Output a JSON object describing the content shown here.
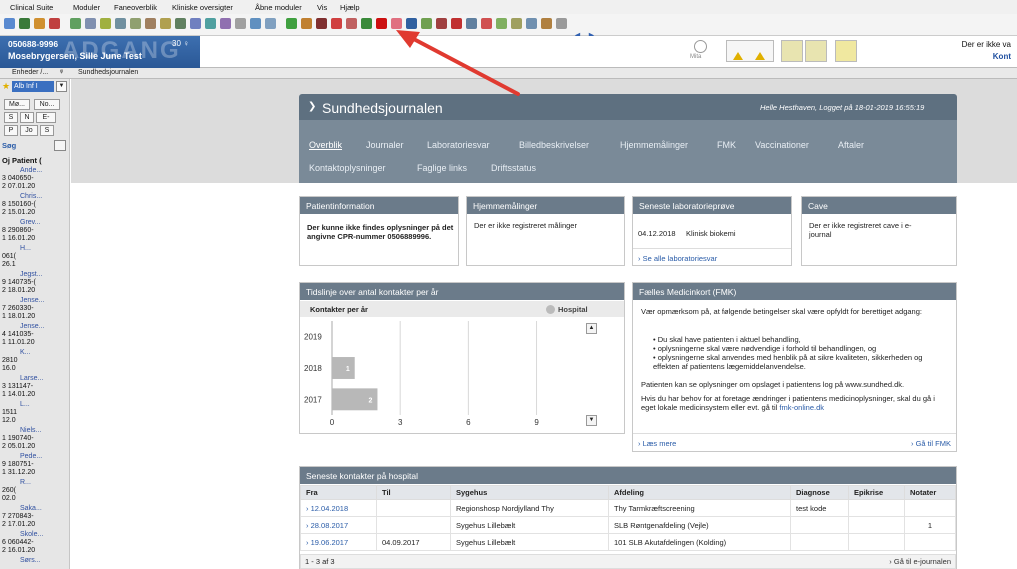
{
  "menubar": [
    "Clinical Suite",
    "Moduler",
    "Faneoverblik",
    "Kliniske oversigter",
    "Åbne moduler",
    "Vis",
    "Hjælp"
  ],
  "patient": {
    "cpr": "050688-9996",
    "age": "30 ♀",
    "name": "Mosebrygersen, Sille June Test",
    "watermark": "ADGANG",
    "warning_line1": "Der er ikke va",
    "warning_line2": "Kont",
    "mia_label": "Mita"
  },
  "tabs": {
    "left_tab": "Enheder /...",
    "pin": "ᵠ",
    "main_tab": "Sundhedsjournalen"
  },
  "sidebar": {
    "filter": "Alb Inf I",
    "buttons_row1": [
      "Mø...",
      "No..."
    ],
    "buttons_row2": [
      "S",
      "N",
      "E-"
    ],
    "buttons_row3": [
      "P",
      "Jo",
      "S"
    ],
    "search": "Søg",
    "header": "Oj Patient (",
    "patients": [
      {
        "name": "Ande...",
        "num": "3",
        "cpr": "040650-",
        "n2": "2",
        "date": "07.01.20"
      },
      {
        "name": "Chris...",
        "num": "8",
        "cpr": "150160-(",
        "n2": "2",
        "date": "15.01.20"
      },
      {
        "name": "Grev...",
        "num": "8",
        "cpr": "290860-",
        "n2": "1",
        "date": "16.01.20"
      },
      {
        "name": "H...",
        "num": "",
        "cpr": "061(",
        "n2": "",
        "date": "26.1"
      },
      {
        "name": "Jegst...",
        "num": "9",
        "cpr": "140735-(",
        "n2": "2",
        "date": "18.01.20"
      },
      {
        "name": "Jense...",
        "num": "7",
        "cpr": "260330-",
        "n2": "1",
        "date": "18.01.20"
      },
      {
        "name": "Jense...",
        "num": "4",
        "cpr": "141035-",
        "n2": "1",
        "date": "11.01.20"
      },
      {
        "name": "K...",
        "num": "",
        "cpr": "2810",
        "n2": "",
        "date": "16.0"
      },
      {
        "name": "Larse...",
        "num": "3",
        "cpr": "131147-",
        "n2": "1",
        "date": "14.01.20"
      },
      {
        "name": "L...",
        "num": "",
        "cpr": "1511",
        "n2": "",
        "date": "12.0"
      },
      {
        "name": "Niels...",
        "num": "1",
        "cpr": "190740-",
        "n2": "2",
        "date": "05.01.20"
      },
      {
        "name": "Pede...",
        "num": "9",
        "cpr": "180751-",
        "n2": "1",
        "date": "31.12.20"
      },
      {
        "name": "R...",
        "num": "",
        "cpr": "260(",
        "n2": "",
        "date": "02.0"
      },
      {
        "name": "Saka...",
        "num": "7",
        "cpr": "270843-",
        "n2": "2",
        "date": "17.01.20"
      },
      {
        "name": "Skole...",
        "num": "6",
        "cpr": "060442-",
        "n2": "2",
        "date": "16.01.20"
      },
      {
        "name": "Sørs...",
        "num": "",
        "cpr": "",
        "n2": "",
        "date": ""
      }
    ]
  },
  "sj": {
    "title": "Sundhedsjournalen",
    "login": "Helle Hesthaven, Logget på 18-01-2019 16:55:19",
    "nav_row1": [
      "Overblik",
      "Journaler",
      "Laboratoriesvar",
      "Billedbeskrivelser",
      "Hjemmemålinger",
      "FMK",
      "Vaccinationer",
      "Aftaler"
    ],
    "nav_row2": [
      "Kontaktoplysninger",
      "Faglige links",
      "Driftsstatus"
    ]
  },
  "widgets": {
    "patientinfo": {
      "title": "Patientinformation",
      "body": "Der kunne ikke findes oplysninger på det angivne CPR-nummer 0506889996."
    },
    "hjemme": {
      "title": "Hjemmemålinger",
      "body": "Der er ikke registreret målinger"
    },
    "lab": {
      "title": "Seneste laboratorieprøve",
      "date": "04.12.2018",
      "type": "Klinisk biokemi",
      "link": "Se alle laboratoriesvar"
    },
    "cave": {
      "title": "Cave",
      "body": "Der er ikke registreret cave i e-journal"
    },
    "timeline": {
      "title": "Tidslinje over antal kontakter per år",
      "subtitle": "Kontakter per år",
      "legend": "Hospital"
    },
    "fmk": {
      "title": "Fælles Medicinkort (FMK)",
      "intro": "Vær opmærksom på, at følgende betingelser skal være opfyldt for berettiget adgang:",
      "bullets": [
        "Du skal have patienten i aktuel behandling,",
        "oplysningerne skal være nødvendige i forhold til behandlingen, og",
        "oplysningerne skal anvendes med henblik på at sikre kvaliteten, sikkerheden og effekten af patientens lægemiddelanvendelse."
      ],
      "log_text": "Patienten kan se oplysninger om opslaget i patientens log på www.sundhed.dk.",
      "change_text": "Hvis du har behov for at foretage ændringer i patientens medicinoplysninger, skal du gå i eget lokale medicinsystem eller evt. gå til",
      "change_link": "fmk-online.dk",
      "read_more": "Læs mere",
      "goto": "Gå til FMK"
    },
    "contacts": {
      "title": "Seneste kontakter på hospital",
      "headers": [
        "Fra",
        "Til",
        "Sygehus",
        "Afdeling",
        "Diagnose",
        "Epikrise",
        "Notater"
      ],
      "rows": [
        [
          "12.04.2018",
          "",
          "Regionshosp Nordjylland Thy",
          "Thy Tarmkræftscreening",
          "test kode",
          "",
          ""
        ],
        [
          "28.08.2017",
          "",
          "Sygehus Lillebælt",
          "SLB Røntgenafdeling (Vejle)",
          "",
          "",
          "1"
        ],
        [
          "19.06.2017",
          "04.09.2017",
          "Sygehus Lillebælt",
          "101 SLB Akutafdelingen (Kolding)",
          "",
          "",
          ""
        ]
      ],
      "footer_count": "1 - 3 af 3",
      "footer_link": "Gå til e-journalen"
    }
  },
  "chart_data": {
    "type": "bar",
    "orientation": "horizontal",
    "categories": [
      "2019",
      "2018",
      "2017"
    ],
    "series": [
      {
        "name": "Hospital",
        "values": [
          0,
          1,
          2
        ]
      }
    ],
    "x_ticks": [
      "0",
      "3",
      "6",
      "9"
    ],
    "xlim": [
      0,
      11
    ],
    "grid": true,
    "legend": "top-right"
  }
}
